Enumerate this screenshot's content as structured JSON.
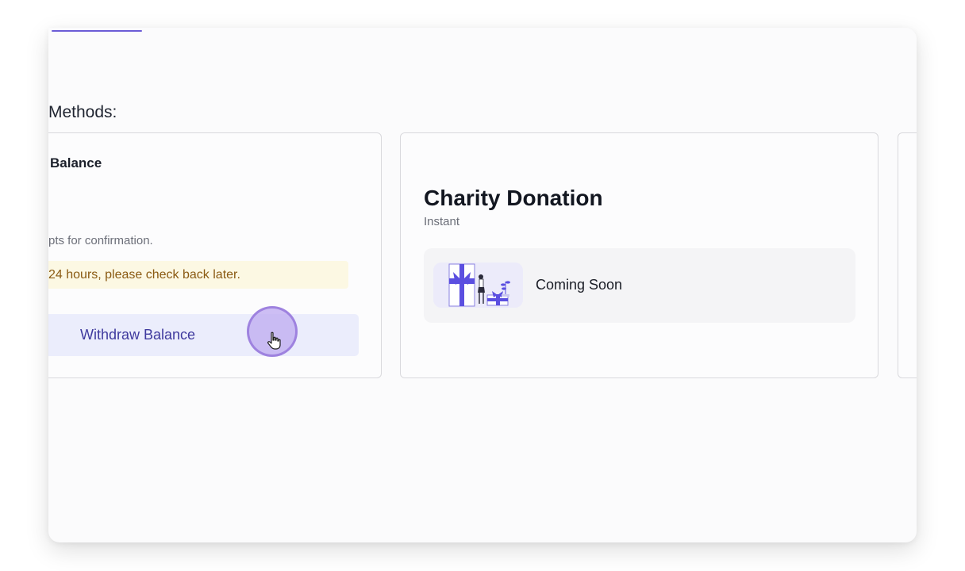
{
  "section": {
    "title": "Methods:"
  },
  "left_card": {
    "heading": "Balance",
    "note": "pts for confirmation.",
    "warning": "24 hours, please check back later.",
    "button_label": "Withdraw Balance"
  },
  "charity_card": {
    "title": "Charity Donation",
    "subtitle": "Instant",
    "status": "Coming Soon",
    "illustration": "gift-illustration"
  },
  "colors": {
    "accent": "#6b5cd6",
    "warning_bg": "#fcf8e3",
    "warning_text": "#8a5a12",
    "button_bg": "#ebedfc",
    "button_text": "#3f3a9e"
  }
}
